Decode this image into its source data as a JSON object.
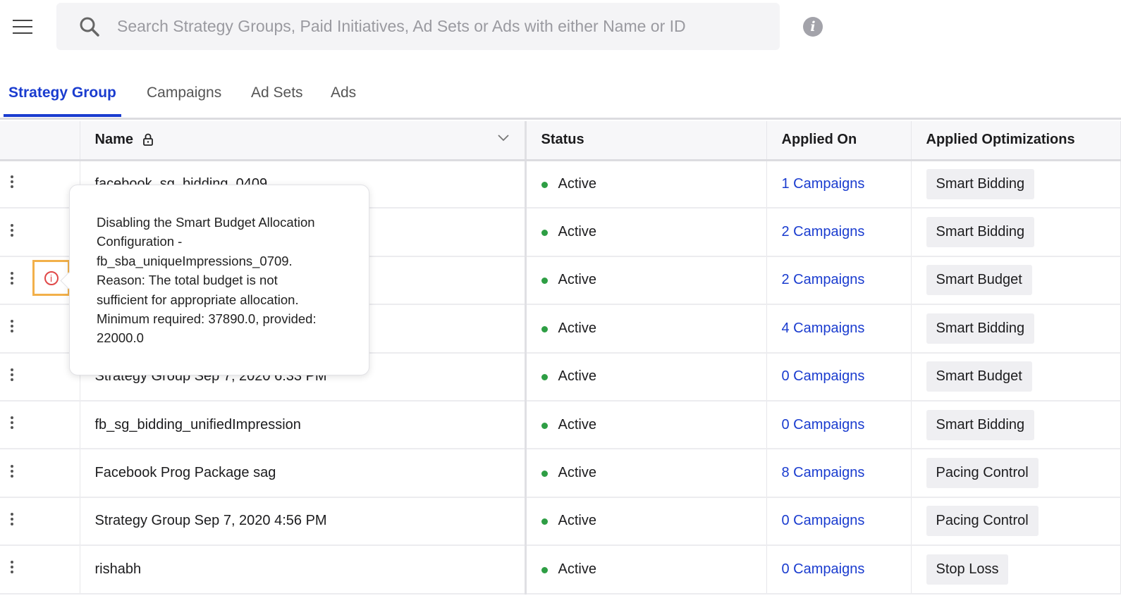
{
  "search": {
    "placeholder": "Search Strategy Groups, Paid Initiatives, Ad Sets or Ads with either Name or ID"
  },
  "tabs": [
    "Strategy Group",
    "Campaigns",
    "Ad Sets",
    "Ads"
  ],
  "columns": {
    "name": "Name",
    "status": "Status",
    "applied_on": "Applied On",
    "optimizations": "Applied Optimizations"
  },
  "rows": [
    {
      "name": "facebook_sg_bidding_0409",
      "status": "Active",
      "applied_on": "1 Campaigns",
      "optimization": "Smart Bidding"
    },
    {
      "name": "",
      "status": "Active",
      "applied_on": "2 Campaigns",
      "optimization": "Smart Bidding"
    },
    {
      "name": "",
      "status": "Active",
      "applied_on": "2 Campaigns",
      "optimization": "Smart Budget"
    },
    {
      "name": "",
      "status": "Active",
      "applied_on": "4 Campaigns",
      "optimization": "Smart Bidding"
    },
    {
      "name": "Strategy Group Sep 7, 2020 6:33 PM",
      "status": "Active",
      "applied_on": "0 Campaigns",
      "optimization": "Smart Budget"
    },
    {
      "name": "fb_sg_bidding_unifiedImpression",
      "status": "Active",
      "applied_on": "0 Campaigns",
      "optimization": "Smart Bidding"
    },
    {
      "name": "Facebook Prog Package sag",
      "status": "Active",
      "applied_on": "8 Campaigns",
      "optimization": "Pacing Control"
    },
    {
      "name": "Strategy Group Sep 7, 2020 4:56 PM",
      "status": "Active",
      "applied_on": "0 Campaigns",
      "optimization": "Pacing Control"
    },
    {
      "name": "rishabh",
      "status": "Active",
      "applied_on": "0 Campaigns",
      "optimization": "Stop Loss"
    }
  ],
  "tooltip": {
    "lines": [
      "Disabling the Smart Budget Allocation",
      "Configuration -",
      "fb_sba_uniqueImpressions_0709.",
      "Reason: The total budget is not",
      "sufficient for appropriate allocation.",
      "Minimum required: 37890.0, provided:",
      "22000.0"
    ]
  },
  "colors": {
    "accent": "#1a3ccf",
    "active": "#2e9e44",
    "error": "#e04848",
    "highlight": "#f2b04a"
  }
}
